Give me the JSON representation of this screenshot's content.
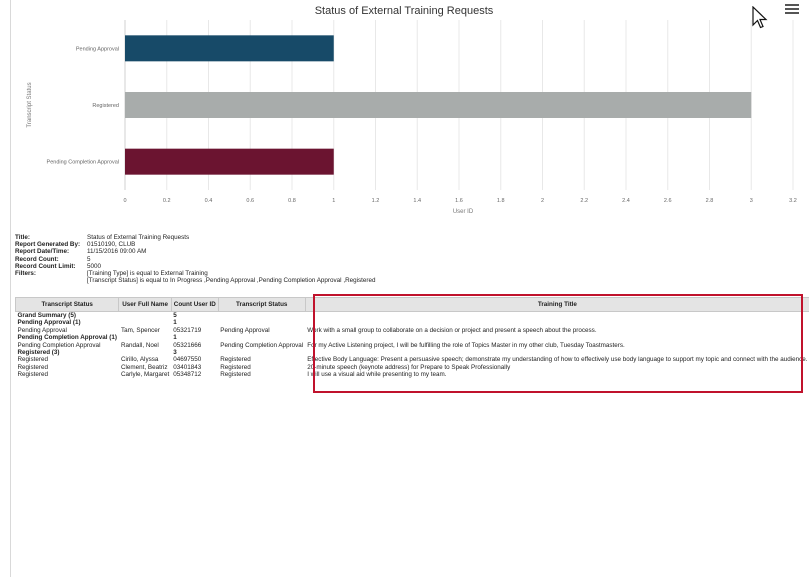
{
  "chart_data": {
    "type": "bar",
    "orientation": "horizontal",
    "title": "Status of External Training Requests",
    "categories": [
      "Pending Approval",
      "Registered",
      "Pending Completion Approval"
    ],
    "values": [
      1,
      3,
      1
    ],
    "colors": [
      "#174a68",
      "#a8acab",
      "#6b1430"
    ],
    "xlabel": "User ID",
    "ylabel": "Transcript Status",
    "xlim": [
      0,
      3.2
    ],
    "xticks": [
      "0",
      "0.2",
      "0.4",
      "0.6",
      "0.8",
      "1",
      "1.2",
      "1.4",
      "1.6",
      "1.8",
      "2",
      "2.2",
      "2.4",
      "2.6",
      "2.8",
      "3",
      "3.2"
    ],
    "grid": true
  },
  "icons": {
    "menu": "hamburger-menu-icon",
    "cursor": "mouse-pointer-icon"
  },
  "meta": [
    {
      "k": "Title:",
      "v": "Status of External Training Requests"
    },
    {
      "k": "Report Generated By:",
      "v": "01510190, CLUB"
    },
    {
      "k": "Report Date/Time:",
      "v": "11/15/2016 09:00 AM"
    },
    {
      "k": "Record Count:",
      "v": "5"
    },
    {
      "k": "Record Count Limit:",
      "v": "5000"
    },
    {
      "k": "Filters:",
      "v": "[Training Type] is equal to External Training"
    },
    {
      "k": "",
      "v": "[Transcript Status] is equal to In Progress ,Pending Approval ,Pending Completion Approval ,Registered"
    }
  ],
  "table": {
    "headers": [
      "Transcript Status",
      "User Full Name",
      "Count User ID",
      "Transcript Status",
      "Training Title"
    ],
    "rows": [
      {
        "group": true,
        "cells": [
          "Grand Summary (5)",
          "",
          "5",
          "",
          ""
        ]
      },
      {
        "group": true,
        "cells": [
          "Pending Approval (1)",
          "",
          "1",
          "",
          ""
        ]
      },
      {
        "group": false,
        "cells": [
          "Pending Approval",
          "Tam, Spencer",
          "05321719",
          "Pending Approval",
          "Work with a small group to collaborate on a decision or project and present a speech about the process."
        ]
      },
      {
        "group": true,
        "cells": [
          "Pending Completion Approval (1)",
          "",
          "1",
          "",
          ""
        ]
      },
      {
        "group": false,
        "cells": [
          "Pending Completion Approval",
          "Randall, Noel",
          "05321666",
          "Pending Completion Approval",
          "For my Active Listening project, I will be fulfilling the role of Topics Master in my other club, Tuesday Toastmasters."
        ]
      },
      {
        "group": true,
        "cells": [
          "Registered (3)",
          "",
          "3",
          "",
          ""
        ]
      },
      {
        "group": false,
        "cells": [
          "Registered",
          "Cirillo, Alyssa",
          "04697550",
          "Registered",
          "Effective Body Language: Present a persuasive speech; demonstrate my understanding of how to effectively use body language to support my topic and connect with the audience."
        ]
      },
      {
        "group": false,
        "cells": [
          "Registered",
          "Clement, Beatriz",
          "03401843",
          "Registered",
          "20-minute speech (keynote address) for Prepare to Speak Professionally"
        ]
      },
      {
        "group": false,
        "cells": [
          "Registered",
          "Carlyle, Margaret",
          "05348712",
          "Registered",
          "I will use a visual aid while presenting to my team."
        ]
      }
    ]
  }
}
